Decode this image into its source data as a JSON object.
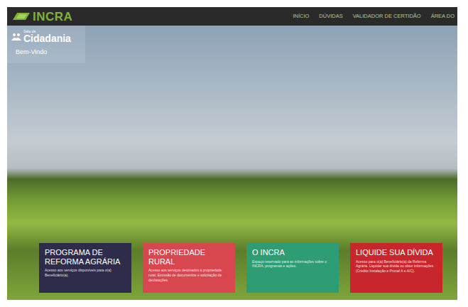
{
  "logo": {
    "text": "INCRA"
  },
  "nav": [
    {
      "label": "INÍCIO"
    },
    {
      "label": "DÚVIDAS"
    },
    {
      "label": "VALIDADOR DE CERTIDÃO"
    },
    {
      "label": "ÁREA DO"
    }
  ],
  "brand": {
    "small": "Sala da",
    "name": "Cidadania",
    "welcome": "Bem-Vindo"
  },
  "cards": [
    {
      "title": "PROGRAMA DE REFORMA AGRÁRIA",
      "text": "Acesso aos serviços disponíveis para o(a) Beneficiário(a).",
      "color": "#2e2b4b"
    },
    {
      "title": "PROPRIEDADE RURAL",
      "text": "Acesso aos serviços destinados à propriedade rural. Emissão de documentos e solicitação de declarações.",
      "color": "#d8464f"
    },
    {
      "title": "O INCRA",
      "text": "Espaço reservado para as informações sobre o INCRA, programas e ações.",
      "color": "#2f9d74"
    },
    {
      "title": "LIQUIDE SUA DÍVIDA",
      "text": "Acesso para o(a) Beneficiário(a) da Reforma Agrária. Liquidar sua dívida ou obter informações (Crédito Instalação e Pronaf A e A/C).",
      "color": "#c7262c"
    }
  ]
}
